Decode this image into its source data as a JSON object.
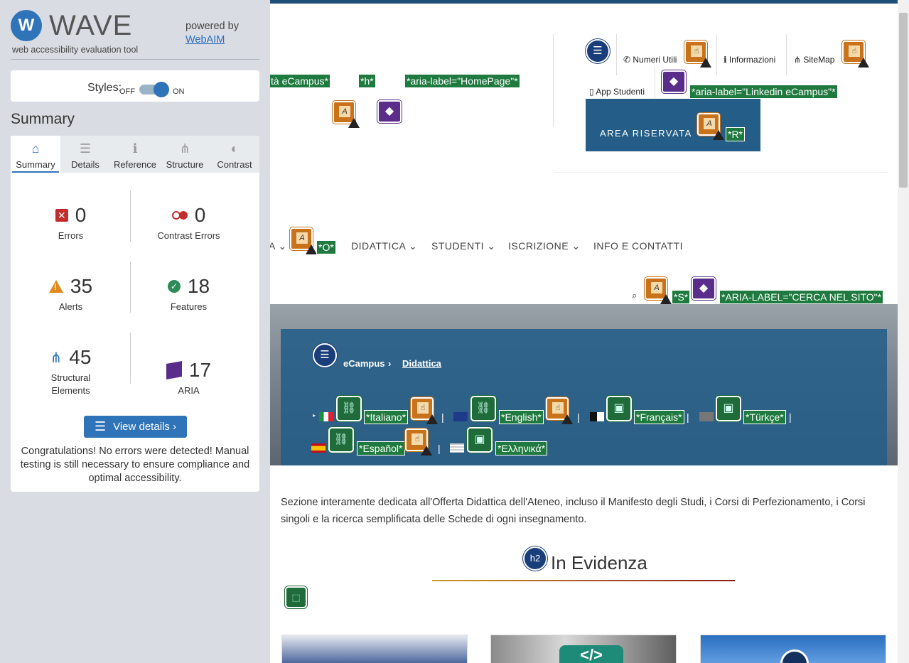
{
  "wave": {
    "logo_letter": "W",
    "title": "WAVE",
    "subtitle": "web accessibility evaluation tool",
    "powered_by": "powered by",
    "webaim": "WebAIM",
    "styles_label": "Styles:",
    "styles_off": "OFF",
    "styles_on": "ON",
    "summary_heading": "Summary",
    "tabs": [
      {
        "label": "Summary",
        "icon": "⌂"
      },
      {
        "label": "Details",
        "icon": "☰"
      },
      {
        "label": "Reference",
        "icon": "ℹ"
      },
      {
        "label": "Structure",
        "icon": "⋔"
      },
      {
        "label": "Contrast",
        "icon": "◐"
      }
    ],
    "stats": {
      "errors": {
        "count": "0",
        "label": "Errors"
      },
      "contrast": {
        "count": "0",
        "label": "Contrast Errors"
      },
      "alerts": {
        "count": "35",
        "label": "Alerts"
      },
      "features": {
        "count": "18",
        "label": "Features"
      },
      "structural": {
        "count": "45",
        "label": "Structural Elements"
      },
      "aria": {
        "count": "17",
        "label": "ARIA"
      }
    },
    "view_details": "View details ›",
    "congrats": "Congratulations! No errors were detected! Manual testing is still necessary to ensure compliance and optimal accessibility."
  },
  "site": {
    "label_ecampus": "tà eCampus*",
    "label_h": "*h*",
    "label_homepage": "*aria-label=\"HomePage\"*",
    "util": {
      "numeri": "Numeri Utili",
      "info": "Informazioni",
      "sitemap": "SiteMap",
      "app": "App Studenti",
      "linkedin": "*aria-label=\"Linkedin eCampus\"*"
    },
    "area_riservata": "AREA RISERVATA",
    "label_r": "*R*",
    "nav": {
      "partial": "A",
      "label_o": "*O*",
      "didattica": "DIDATTICA",
      "studenti": "STUDENTI",
      "iscrizione": "ISCRIZIONE",
      "info": "INFO E CONTATTI"
    },
    "label_s": "*S*",
    "label_cerca": "*ARIA-LABEL=\"CERCA NEL SITO\"*",
    "breadcrumb": {
      "home": "eCampus",
      "sep": "›",
      "current": "Didattica"
    },
    "langs": {
      "it": "*Italiano*",
      "en": "*English*",
      "fr": "*Français*",
      "tr": "*Türkçe*",
      "es": "*Español*",
      "el": "*Ελληνικά*"
    },
    "intro": "Sezione interamente dedicata all'Offerta Didattica dell'Ateneo, incluso il Manifesto degli Studi, i Corsi di Perfezionamento, i Corsi singoli e la ricerca semplificata delle Schede di ogni insegnamento.",
    "h2_badge": "h2",
    "h2": "In Evidenza",
    "card_code_icon": "</>",
    "colors": {
      "wave_blue": "#2f73b8",
      "site_blue": "#245d87",
      "wave_green": "#1f7a3f",
      "aria_purple": "#5a2d8a"
    }
  }
}
